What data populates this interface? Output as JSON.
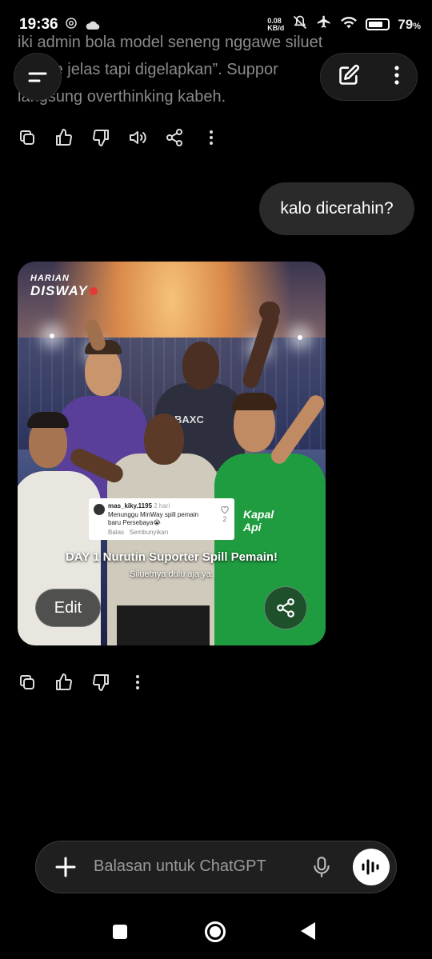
{
  "status_bar": {
    "time": "19:36",
    "net_speed_value": "0.08",
    "net_speed_unit": "KB/d",
    "battery_pct": "79",
    "battery_fill": 0.79,
    "left_icons": [
      "chatgpt-icon",
      "cloud-icon"
    ],
    "right_icons": [
      "mute-icon",
      "airplane-icon",
      "wifi-icon",
      "battery-icon"
    ]
  },
  "chat": {
    "previous_text_lines": [
      "iki admin bola model seneng nggawe siluet",
      "“...ane jelas tapi digelapkan”. Suppor",
      "langsung overthinking kabeh."
    ],
    "user_message": "kalo dicerahin?"
  },
  "image_card": {
    "logo_line1": "HARIAN",
    "logo_line2": "DISWAY",
    "comment": {
      "username": "mas_kiky.1195",
      "time": "2 hari",
      "message": "Menunggu MinWay spill pemain baru Persebaya😭",
      "reply_label": "Balas",
      "hide_label": "Sembunyikan",
      "likes": "2"
    },
    "caption": "DAY 1 Nurutin Suporter Spill Pemain!",
    "subcaption": "Siluetnya dulu aja ya.",
    "edit_label": "Edit",
    "jersey_text": "BAXC",
    "sponsor_text": "Kapal Api"
  },
  "composer": {
    "placeholder": "Balasan untuk ChatGPT"
  },
  "colors": {
    "background": "#000000",
    "bubble": "#2a2a2a",
    "muted_text": "#8a8a8a"
  }
}
